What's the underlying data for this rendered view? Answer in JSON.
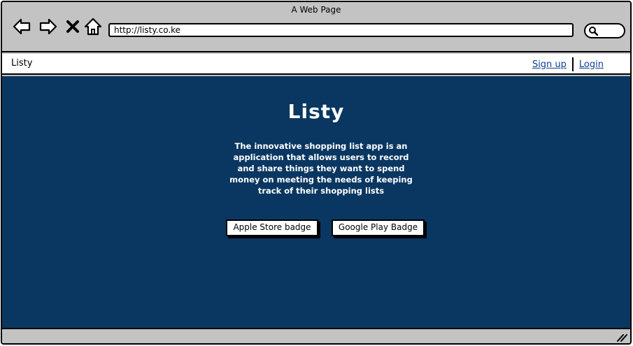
{
  "window": {
    "title": "A Web Page"
  },
  "toolbar": {
    "back_icon": "arrow-left-icon",
    "forward_icon": "arrow-right-icon",
    "stop_icon": "close-icon",
    "home_icon": "home-icon",
    "url": "http://listy.co.ke",
    "search_icon": "search-icon"
  },
  "nav": {
    "brand": "Listy",
    "signup_label": "Sign up",
    "login_label": "Login"
  },
  "hero": {
    "title": "Listy",
    "description": "The innovative shopping list app is an application that allows users to record and share things they want to spend money on meeting the needs of keeping track of their shopping lists",
    "apple_badge_label": "Apple Store badge",
    "google_badge_label": "Google Play Badge"
  },
  "colors": {
    "hero_bg": "#0a3761",
    "chrome_bg": "#c3c3c3",
    "link": "#0b3f8f"
  }
}
